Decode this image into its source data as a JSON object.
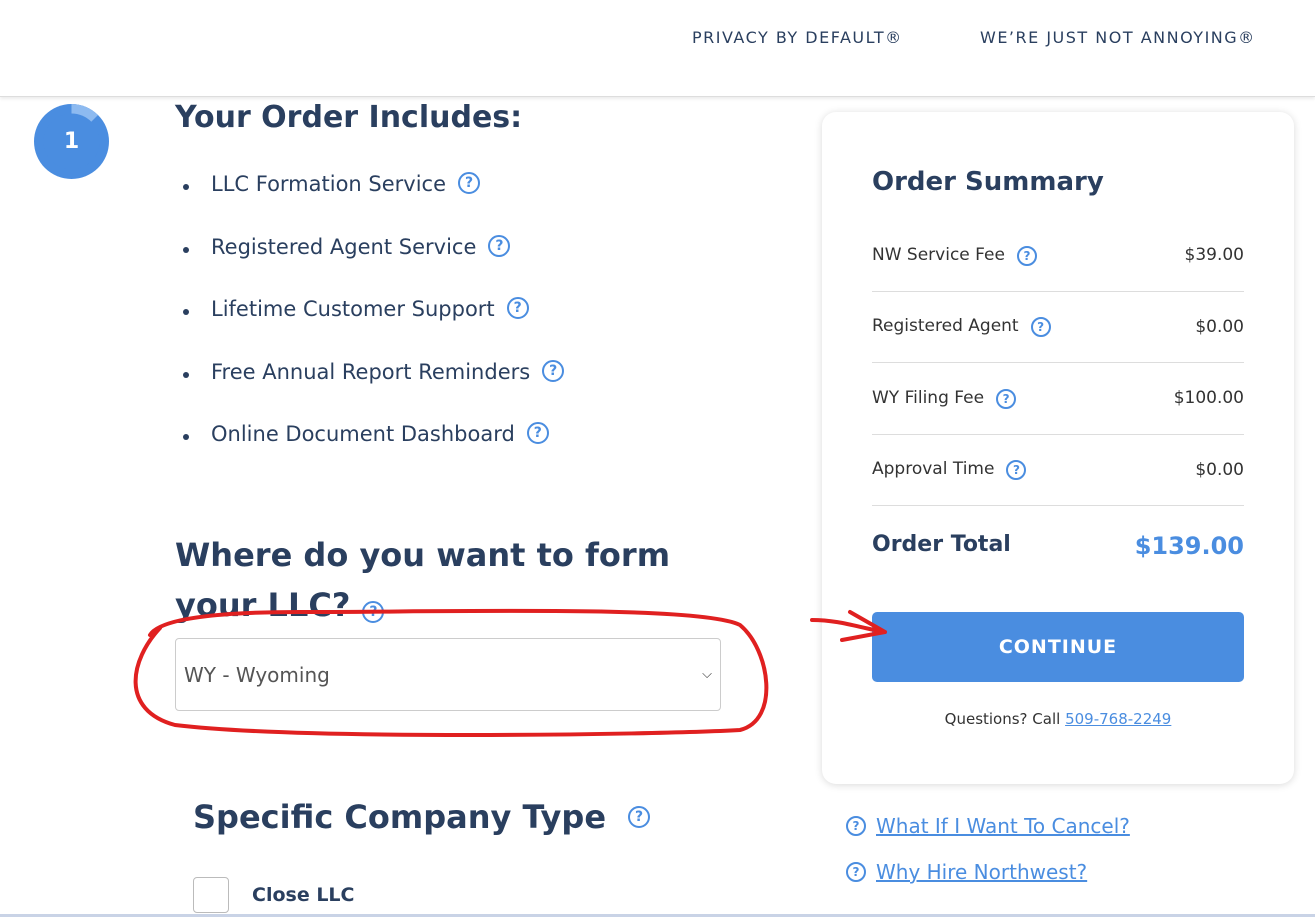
{
  "header": {
    "nav": [
      "PRIVACY BY DEFAULT®",
      "WE’RE JUST NOT ANNOYING®"
    ]
  },
  "step": {
    "number": "1",
    "progress": 0.1
  },
  "includes": {
    "title": "Your Order Includes:",
    "items": [
      "LLC Formation Service",
      "Registered Agent Service",
      "Lifetime Customer Support",
      "Free Annual Report Reminders",
      "Online Document Dashboard"
    ]
  },
  "state": {
    "question": "Where do you want to form your LLC?",
    "selected": "WY - Wyoming"
  },
  "company_type": {
    "title": "Specific Company Type",
    "option": "Close LLC"
  },
  "summary": {
    "title": "Order Summary",
    "rows": [
      {
        "label": "NW Service Fee",
        "amount": "$39.00"
      },
      {
        "label": "Registered Agent",
        "amount": "$0.00"
      },
      {
        "label": "WY Filing Fee",
        "amount": "$100.00"
      },
      {
        "label": "Approval Time",
        "amount": "$0.00"
      }
    ],
    "total_label": "Order Total",
    "total": "$139.00",
    "continue": "CONTINUE",
    "questions": "Questions? Call",
    "phone": "509-768-2249"
  },
  "links": [
    "What If I Want To Cancel?",
    "Why Hire Northwest?"
  ],
  "help_glyph": "?",
  "colors": {
    "accent": "#4a8de0",
    "navy": "#2a3f5f",
    "annotation": "#e02020"
  }
}
